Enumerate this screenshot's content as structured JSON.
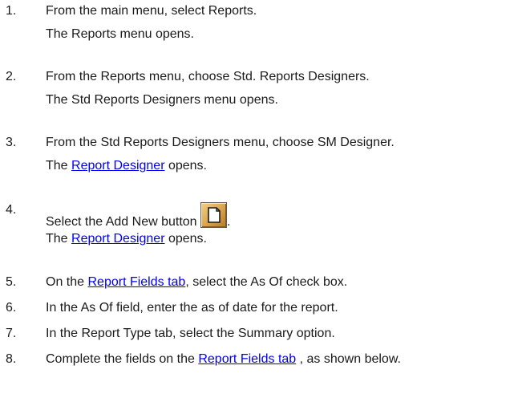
{
  "steps": [
    {
      "number": "1.",
      "line1": "From the main menu, select Reports.",
      "line2": "The Reports menu opens."
    },
    {
      "number": "2.",
      "line1": "From the Reports menu, choose Std. Reports Designers.",
      "line2": "The Std Reports Designers menu opens."
    },
    {
      "number": "3.",
      "line1": "From the Std Reports Designers menu, choose SM Designer.",
      "line2_pre": "The ",
      "line2_link": "Report Designer",
      "line2_post": " opens."
    },
    {
      "number": "4.",
      "line1_pre": "Select the Add New button ",
      "line1_icon": "new-document-icon",
      "line1_post": ".",
      "line2_pre": "The ",
      "line2_link": "Report Designer",
      "line2_post": " opens."
    },
    {
      "number": "5.",
      "pre": "On the ",
      "link": "Report Fields tab",
      "post": ", select the As Of check box."
    },
    {
      "number": "6.",
      "text": "In the As Of field, enter the as of date for the report."
    },
    {
      "number": "7.",
      "text": "In the Report Type tab, select the Summary option."
    },
    {
      "number": "8.",
      "pre": "Complete the fields on the ",
      "link": "Report Fields tab",
      "post": " , as shown below."
    }
  ],
  "colors": {
    "link": "#0000ee",
    "text": "#1a1a1a",
    "icon_fill": "#d9a24b"
  }
}
